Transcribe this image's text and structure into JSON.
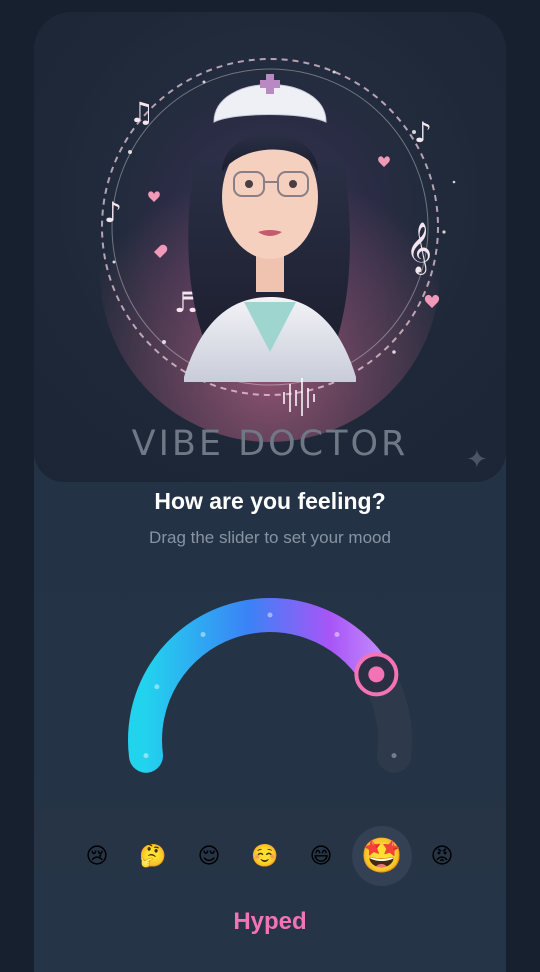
{
  "app": {
    "title": "VIBE DOCTOR"
  },
  "prompt": {
    "heading": "How are you feeling?",
    "subheading": "Drag the slider to set your mood"
  },
  "slider": {
    "value_fraction": 0.8,
    "selected_index": 5,
    "gradient_colors": [
      "#22d3ee",
      "#3b82f6",
      "#a855f7",
      "#f472b6"
    ],
    "thumb_color": "#f472b6"
  },
  "moods": [
    {
      "emoji": "😢",
      "name": "crying-face-icon"
    },
    {
      "emoji": "🤔",
      "name": "thinking-face-icon"
    },
    {
      "emoji": "😌",
      "name": "relieved-face-icon"
    },
    {
      "emoji": "☺️",
      "name": "smiling-face-icon"
    },
    {
      "emoji": "😄",
      "name": "grinning-face-icon"
    },
    {
      "emoji": "🤩",
      "name": "star-struck-icon"
    },
    {
      "emoji": "😡",
      "name": "angry-face-icon"
    }
  ],
  "selected_mood": {
    "label": "Hyped"
  },
  "colors": {
    "accent": "#f472b6",
    "background": "#16202f",
    "card": "#243245"
  }
}
